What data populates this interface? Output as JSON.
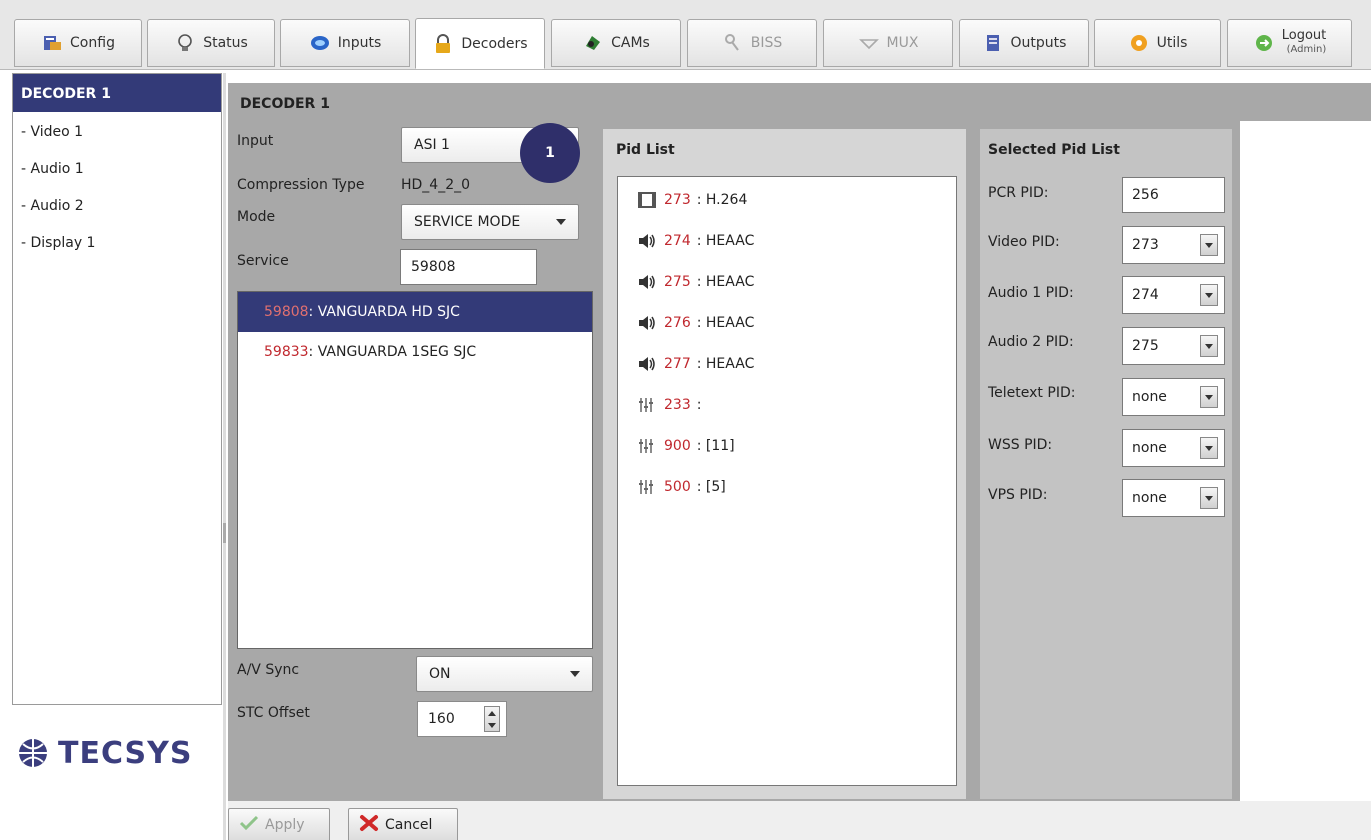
{
  "tabs": [
    {
      "label": "Config",
      "icon": "config-icon"
    },
    {
      "label": "Status",
      "icon": "bulb-icon"
    },
    {
      "label": "Inputs",
      "icon": "inputs-icon"
    },
    {
      "label": "Decoders",
      "icon": "lock-icon",
      "active": true
    },
    {
      "label": "CAMs",
      "icon": "cam-icon"
    },
    {
      "label": "BISS",
      "icon": "key-icon",
      "disabled": true
    },
    {
      "label": "MUX",
      "icon": "mux-icon",
      "disabled": true
    },
    {
      "label": "Outputs",
      "icon": "outputs-icon"
    },
    {
      "label": "Utils",
      "icon": "utils-icon"
    },
    {
      "label": "Logout",
      "sublabel": "(Admin)",
      "icon": "logout-icon"
    }
  ],
  "sidebar": {
    "header": "DECODER 1",
    "items": [
      {
        "label": "- Video 1"
      },
      {
        "label": "- Audio 1"
      },
      {
        "label": "- Audio 2"
      },
      {
        "label": "- Display 1"
      }
    ]
  },
  "logo": {
    "text": "TECSYS"
  },
  "panel": {
    "title": "DECODER 1",
    "input": {
      "label": "Input",
      "value": "ASI 1"
    },
    "badge": "1",
    "compression": {
      "label": "Compression Type",
      "value": "HD_4_2_0"
    },
    "mode": {
      "label": "Mode",
      "value": "SERVICE MODE"
    },
    "service": {
      "label": "Service",
      "value": "59808"
    },
    "services": [
      {
        "id": "59808",
        "name": ": VANGUARDA HD SJC",
        "selected": true
      },
      {
        "id": "59833",
        "name": ": VANGUARDA 1SEG SJC",
        "selected": false
      }
    ],
    "av_sync": {
      "label": "A/V Sync",
      "value": "ON"
    },
    "stc_offset": {
      "label": "STC Offset",
      "value": "160"
    }
  },
  "pid_list": {
    "title": "Pid List",
    "rows": [
      {
        "pid": "273",
        "type": ": H.264",
        "icon": "video-icon"
      },
      {
        "pid": "274",
        "type": ": HEAAC",
        "icon": "audio-icon"
      },
      {
        "pid": "275",
        "type": ": HEAAC",
        "icon": "audio-icon"
      },
      {
        "pid": "276",
        "type": ": HEAAC",
        "icon": "audio-icon"
      },
      {
        "pid": "277",
        "type": ": HEAAC",
        "icon": "audio-icon"
      },
      {
        "pid": "233",
        "type": ":",
        "icon": "data-icon"
      },
      {
        "pid": "900",
        "type": ": [11]",
        "icon": "data-icon"
      },
      {
        "pid": "500",
        "type": ": [5]",
        "icon": "data-icon"
      }
    ]
  },
  "selected_pid_list": {
    "title": "Selected Pid List",
    "pcr": {
      "label": "PCR PID:",
      "value": "256"
    },
    "video": {
      "label": "Video PID:",
      "value": "273"
    },
    "audio1": {
      "label": "Audio 1 PID:",
      "value": "274"
    },
    "audio2": {
      "label": "Audio 2 PID:",
      "value": "275"
    },
    "teletext": {
      "label": "Teletext PID:",
      "value": "none"
    },
    "wss": {
      "label": "WSS PID:",
      "value": "none"
    },
    "vps": {
      "label": "VPS PID:",
      "value": "none"
    }
  },
  "actions": {
    "apply": "Apply",
    "cancel": "Cancel"
  },
  "colors": {
    "selection": "#333a78",
    "pid_red": "#c0282e",
    "panel_gray": "#a8a8a8"
  }
}
